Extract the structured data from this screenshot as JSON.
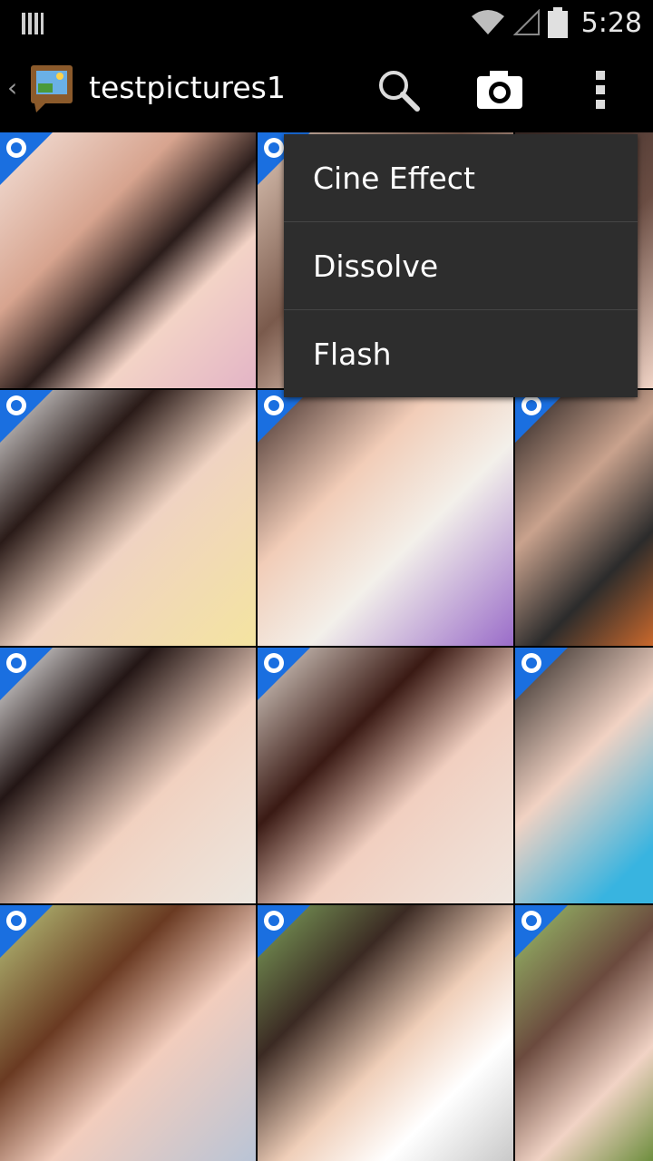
{
  "status_bar": {
    "time": "5:28"
  },
  "action_bar": {
    "title": "testpictures1",
    "icons": [
      "back-chevron-icon",
      "album-icon",
      "search-icon",
      "camera-icon",
      "overflow-menu-icon"
    ]
  },
  "grid": {
    "tiles": [
      {
        "bg": "linear-gradient(135deg,#f4e2da 0%,#d7a48f 35%,#2b1d1b 55%,#f3d3c6 70%,#e3b4c6 100%)"
      },
      {
        "bg": "linear-gradient(135deg,#e0c8b8 0%,#7a5a4c 40%,#f1d6c6 70%,#d7c0a8 100%)"
      },
      {
        "bg": "linear-gradient(135deg,#3a2a26 0%,#6a4d43 50%,#f3d6c8 100%)"
      },
      {
        "bg": "linear-gradient(135deg,#e7e7e7 0%,#2a1b18 30%,#f0d3c2 55%,#f4e4a0 100%)"
      },
      {
        "bg": "linear-gradient(135deg,#3d2a27 0%,#f2cdb8 35%,#f3f0ea 60%,#9a6cc9 100%)"
      },
      {
        "bg": "linear-gradient(135deg,#1f1a1a 0%,#c9a28d 40%,#2b2b2b 70%,#cf6a2c 100%)"
      },
      {
        "bg": "linear-gradient(135deg,#f2f2f2 0%,#231615 30%,#f1d1c0 60%,#ece7e0 100%)"
      },
      {
        "bg": "linear-gradient(135deg,#e1d9d0 0%,#3a1a14 35%,#f1cfc0 60%,#efe6df 100%)"
      },
      {
        "bg": "linear-gradient(135deg,#27221f 0%,#f1d2c3 45%,#38b4e0 85%)"
      },
      {
        "bg": "linear-gradient(135deg,#b7c47a 0%,#6a3a22 35%,#f2cdbd 60%,#b9c4d6 100%)"
      },
      {
        "bg": "linear-gradient(135deg,#7fa55c 0%,#3b2a23 30%,#f0cfb9 55%,#ffffff 75%,#c9c9c9 100%)"
      },
      {
        "bg": "linear-gradient(135deg,#99c26a 0%,#6b4a3e 40%,#f1d3c5 70%,#6a8c3a 100%)"
      }
    ]
  },
  "menu": {
    "items": [
      {
        "label": "Cine Effect"
      },
      {
        "label": "Dissolve"
      },
      {
        "label": "Flash"
      }
    ]
  },
  "colors": {
    "badge": "#1a6fe0",
    "menu_bg": "#2d2d2d",
    "divider": "#454545"
  }
}
